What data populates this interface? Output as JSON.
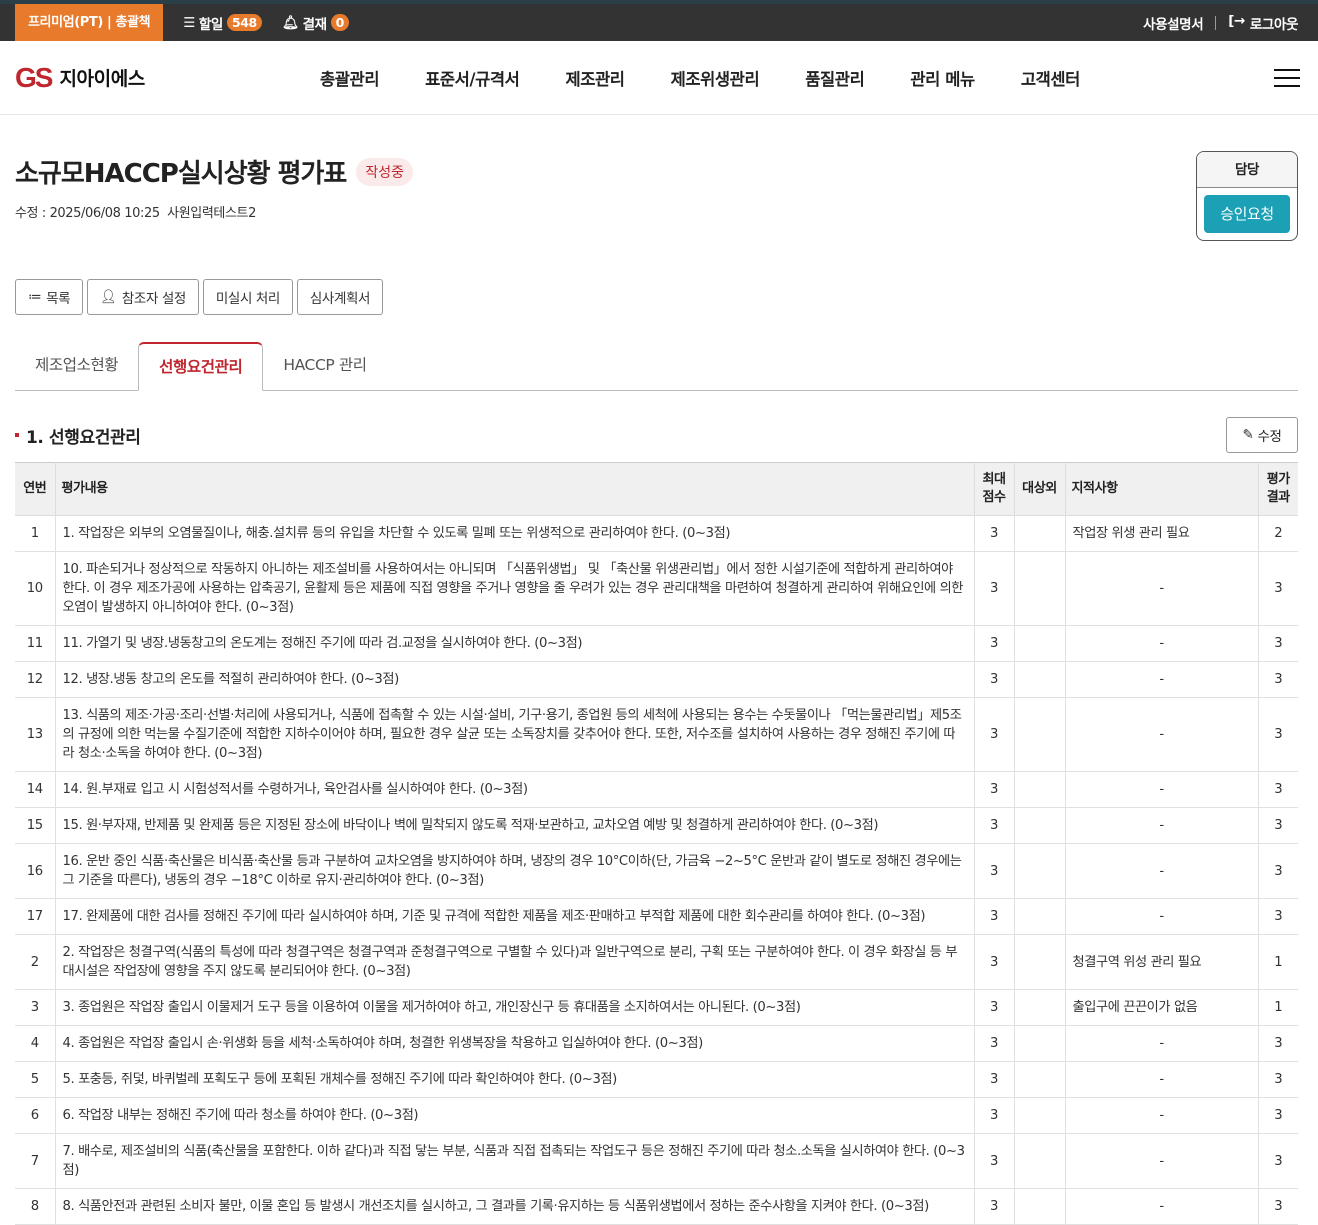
{
  "topbar": {
    "plan": "프리미엄(PT) | 총괄책",
    "todo_label": "할일",
    "todo_count": "548",
    "approval_label": "결재",
    "approval_count": "0",
    "manual": "사용설명서",
    "logout": "로그아웃"
  },
  "header": {
    "logo_mark": "GS",
    "logo_text": "지아이에스",
    "nav": [
      "총괄관리",
      "표준서/규격서",
      "제조관리",
      "제조위생관리",
      "품질관리",
      "관리 메뉴",
      "고객센터"
    ]
  },
  "page": {
    "title": "소규모HACCP실시상황 평가표",
    "status": "작성중",
    "meta": "수정 : 2025/06/08 10:25  사원입력테스트2"
  },
  "approval": {
    "role": "담당",
    "button": "승인요청"
  },
  "actions": [
    "목록",
    "참조자 설정",
    "미실시 처리",
    "심사계획서"
  ],
  "tabs": [
    "제조업소현황",
    "선행요건관리",
    "HACCP 관리"
  ],
  "section": {
    "title": "1. 선행요건관리",
    "edit": "수정"
  },
  "table": {
    "headers": [
      "연번",
      "평가내용",
      "최대\n점수",
      "대상외",
      "지적사항",
      "평가\n결과"
    ],
    "rows": [
      {
        "no": "1",
        "content": "1. 작업장은 외부의 오염물질이나, 해충.설치류 등의 유입을 차단할 수 있도록 밀폐 또는 위생적으로 관리하여야 한다. (0~3점)",
        "max": "3",
        "excluded": "",
        "finding": "작업장 위생 관리 필요",
        "result": "2"
      },
      {
        "no": "10",
        "content": "10. 파손되거나 정상적으로 작동하지 아니하는 제조설비를 사용하여서는 아니되며 「식품위생법」 및 「축산물 위생관리법」에서 정한 시설기준에 적합하게 관리하여야 한다. 이 경우 제조가공에 사용하는 압축공기, 윤활제 등은 제품에 직접 영향을 주거나 영향을 줄 우려가 있는 경우 관리대책을 마련하여 청결하게 관리하여 위해요인에 의한 오염이 발생하지 아니하여야 한다. (0~3점)",
        "max": "3",
        "excluded": "",
        "finding": "-",
        "result": "3"
      },
      {
        "no": "11",
        "content": "11. 가열기 및 냉장.냉동창고의 온도계는 정해진 주기에 따라 검.교정을 실시하여야 한다. (0~3점)",
        "max": "3",
        "excluded": "",
        "finding": "-",
        "result": "3"
      },
      {
        "no": "12",
        "content": "12. 냉장.냉동 창고의 온도를 적절히 관리하여야 한다. (0~3점)",
        "max": "3",
        "excluded": "",
        "finding": "-",
        "result": "3"
      },
      {
        "no": "13",
        "content": "13. 식품의 제조·가공·조리·선별·처리에 사용되거나, 식품에 접촉할 수 있는 시설·설비, 기구·용기, 종업원 등의 세척에 사용되는 용수는 수돗물이나 「먹는물관리법」제5조의 규정에 의한 먹는물 수질기준에 적합한 지하수이어야 하며, 필요한 경우 살균 또는 소독장치를 갖추어야 한다. 또한, 저수조를 설치하여 사용하는 경우 정해진 주기에 따라 청소·소독을 하여야 한다. (0~3점)",
        "max": "3",
        "excluded": "",
        "finding": "-",
        "result": "3"
      },
      {
        "no": "14",
        "content": "14. 원.부재료 입고 시 시험성적서를 수령하거나, 육안검사를 실시하여야 한다. (0~3점)",
        "max": "3",
        "excluded": "",
        "finding": "-",
        "result": "3"
      },
      {
        "no": "15",
        "content": "15. 원·부자재, 반제품 및 완제품 등은 지정된 장소에 바닥이나 벽에 밀착되지 않도록 적재·보관하고, 교차오염 예방 및 청결하게 관리하여야 한다. (0~3점)",
        "max": "3",
        "excluded": "",
        "finding": "-",
        "result": "3"
      },
      {
        "no": "16",
        "content": "16. 운반 중인 식품·축산물은 비식품·축산물 등과 구분하여 교차오염을 방지하여야 하며, 냉장의 경우 10°C이하(단, 가금육 −2~5°C 운반과 같이 별도로 정해진 경우에는 그 기준을 따른다), 냉동의 경우 −18°C 이하로 유지·관리하여야 한다. (0~3점)",
        "max": "3",
        "excluded": "",
        "finding": "-",
        "result": "3"
      },
      {
        "no": "17",
        "content": "17. 완제품에 대한 검사를 정해진 주기에 따라 실시하여야 하며, 기준 및 규격에 적합한 제품을 제조·판매하고 부적합 제품에 대한 회수관리를 하여야 한다. (0~3점)",
        "max": "3",
        "excluded": "",
        "finding": "-",
        "result": "3"
      },
      {
        "no": "2",
        "content": "2. 작업장은 청결구역(식품의 특성에 따라 청결구역은 청결구역과 준청결구역으로 구별할 수 있다)과 일반구역으로 분리, 구획 또는 구분하여야 한다. 이 경우 화장실 등 부대시설은 작업장에 영향을 주지 않도록 분리되어야 한다. (0~3점)",
        "max": "3",
        "excluded": "",
        "finding": "청결구역 위성 관리 필요",
        "result": "1"
      },
      {
        "no": "3",
        "content": "3. 종업원은 작업장 출입시 이물제거 도구 등을 이용하여 이물을 제거하여야 하고, 개인장신구 등 휴대품을 소지하여서는 아니된다. (0~3점)",
        "max": "3",
        "excluded": "",
        "finding": "출입구에 끈끈이가 없음",
        "result": "1"
      },
      {
        "no": "4",
        "content": "4. 종업원은 작업장 출입시 손·위생화 등을 세척·소독하여야 하며, 청결한 위생복장을 착용하고 입실하여야 한다. (0~3점)",
        "max": "3",
        "excluded": "",
        "finding": "-",
        "result": "3"
      },
      {
        "no": "5",
        "content": "5. 포충등, 쥐덫, 바퀴벌레 포획도구 등에 포획된 개체수를 정해진 주기에 따라 확인하여야 한다. (0~3점)",
        "max": "3",
        "excluded": "",
        "finding": "-",
        "result": "3"
      },
      {
        "no": "6",
        "content": "6. 작업장 내부는 정해진 주기에 따라 청소를 하여야 한다. (0~3점)",
        "max": "3",
        "excluded": "",
        "finding": "-",
        "result": "3"
      },
      {
        "no": "7",
        "content": "7. 배수로, 제조설비의 식품(축산물을 포함한다. 이하 같다)과 직접 닿는 부분, 식품과 직접 접촉되는 작업도구 등은 정해진 주기에 따라 청소.소독을 실시하여야 한다. (0~3점)",
        "max": "3",
        "excluded": "",
        "finding": "-",
        "result": "3"
      },
      {
        "no": "8",
        "content": "8. 식품안전과 관련된 소비자 불만, 이물 혼입 등 발생시 개선조치를 실시하고, 그 결과를 기록·유지하는 등 식품위생법에서 정하는 준수사항을 지켜야 한다. (0~3점)",
        "max": "3",
        "excluded": "",
        "finding": "-",
        "result": "3"
      }
    ]
  }
}
